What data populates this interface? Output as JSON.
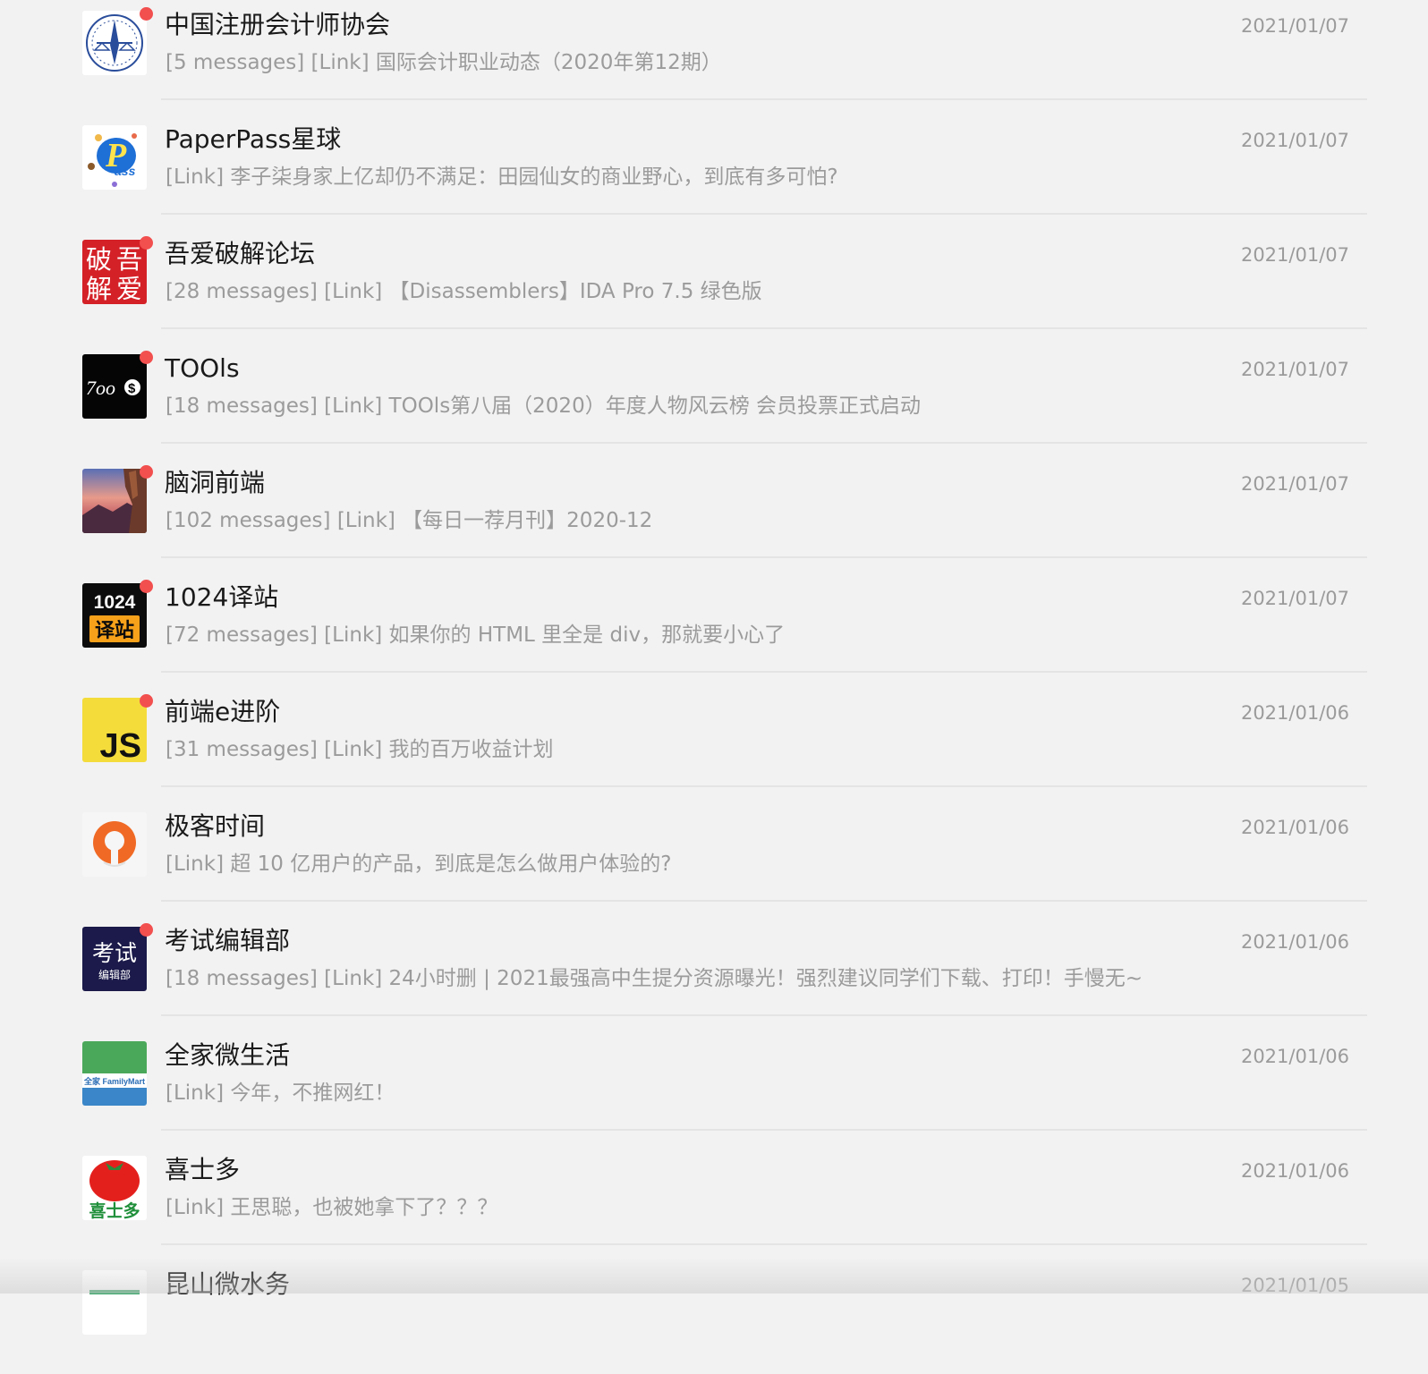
{
  "chats": [
    {
      "title": "中国注册会计师协会",
      "subtitle": "[5 messages] [Link] 国际会计职业动态（2020年第12期）",
      "date": "2021/01/07",
      "unread": true,
      "icon": "cicpa-logo-icon"
    },
    {
      "title": "PaperPass星球",
      "subtitle": "[Link] 李子柒身家上亿却仍不满足：田园仙女的商业野心，到底有多可怕?",
      "date": "2021/01/07",
      "unread": false,
      "icon": "paperpass-logo-icon"
    },
    {
      "title": "吾爱破解论坛",
      "subtitle": "[28 messages] [Link] 【Disassemblers】IDA Pro 7.5 绿色版",
      "date": "2021/01/07",
      "unread": true,
      "icon": "52pojie-logo-icon"
    },
    {
      "title": "TOOls",
      "subtitle": "[18 messages] [Link] TOOls第八届（2020）年度人物风云榜 会员投票正式启动",
      "date": "2021/01/07",
      "unread": true,
      "icon": "tools-logo-icon"
    },
    {
      "title": "脑洞前端",
      "subtitle": "[102 messages] [Link] 【每日一荐月刊】2020-12",
      "date": "2021/01/07",
      "unread": true,
      "icon": "landscape-avatar-icon"
    },
    {
      "title": "1024译站",
      "subtitle": "[72 messages] [Link] 如果你的 HTML 里全是 div，那就要小心了",
      "date": "2021/01/07",
      "unread": true,
      "icon": "1024-logo-icon"
    },
    {
      "title": "前端e进阶",
      "subtitle": "[31 messages] [Link] 我的百万收益计划",
      "date": "2021/01/06",
      "unread": true,
      "icon": "js-logo-icon"
    },
    {
      "title": "极客时间",
      "subtitle": "[Link] 超 10 亿用户的产品，到底是怎么做用户体验的?",
      "date": "2021/01/06",
      "unread": false,
      "icon": "geektime-logo-icon"
    },
    {
      "title": "考试编辑部",
      "subtitle": "[18 messages] [Link] 24小时删 | 2021最强高中生提分资源曝光！强烈建议同学们下载、打印！手慢无~",
      "date": "2021/01/06",
      "unread": true,
      "icon": "exam-logo-icon"
    },
    {
      "title": "全家微生活",
      "subtitle": "[Link] 今年，不推网红！",
      "date": "2021/01/06",
      "unread": false,
      "icon": "familymart-logo-icon"
    },
    {
      "title": "喜士多",
      "subtitle": "[Link] 王思聪，也被她拿下了？？？",
      "date": "2021/01/06",
      "unread": false,
      "icon": "tomato-logo-icon"
    },
    {
      "title": "昆山微水务",
      "subtitle": "",
      "date": "2021/01/05",
      "unread": false,
      "icon": "kunshan-water-logo-icon"
    }
  ],
  "logos": {
    "pojie": [
      "破",
      "吾",
      "解",
      "爱"
    ],
    "tools": "7oo",
    "t1024": [
      "1024",
      "译站"
    ],
    "js": "JS",
    "exam": [
      "考试",
      "编辑部"
    ],
    "familymart": "全家 FamilyMart",
    "tomato": "喜士多",
    "paperpass": "P"
  },
  "colors": {
    "unread_dot": "#f24f4f",
    "title": "#1a1a1a",
    "secondary": "#9b9b9b",
    "background": "#f2f2f2"
  }
}
